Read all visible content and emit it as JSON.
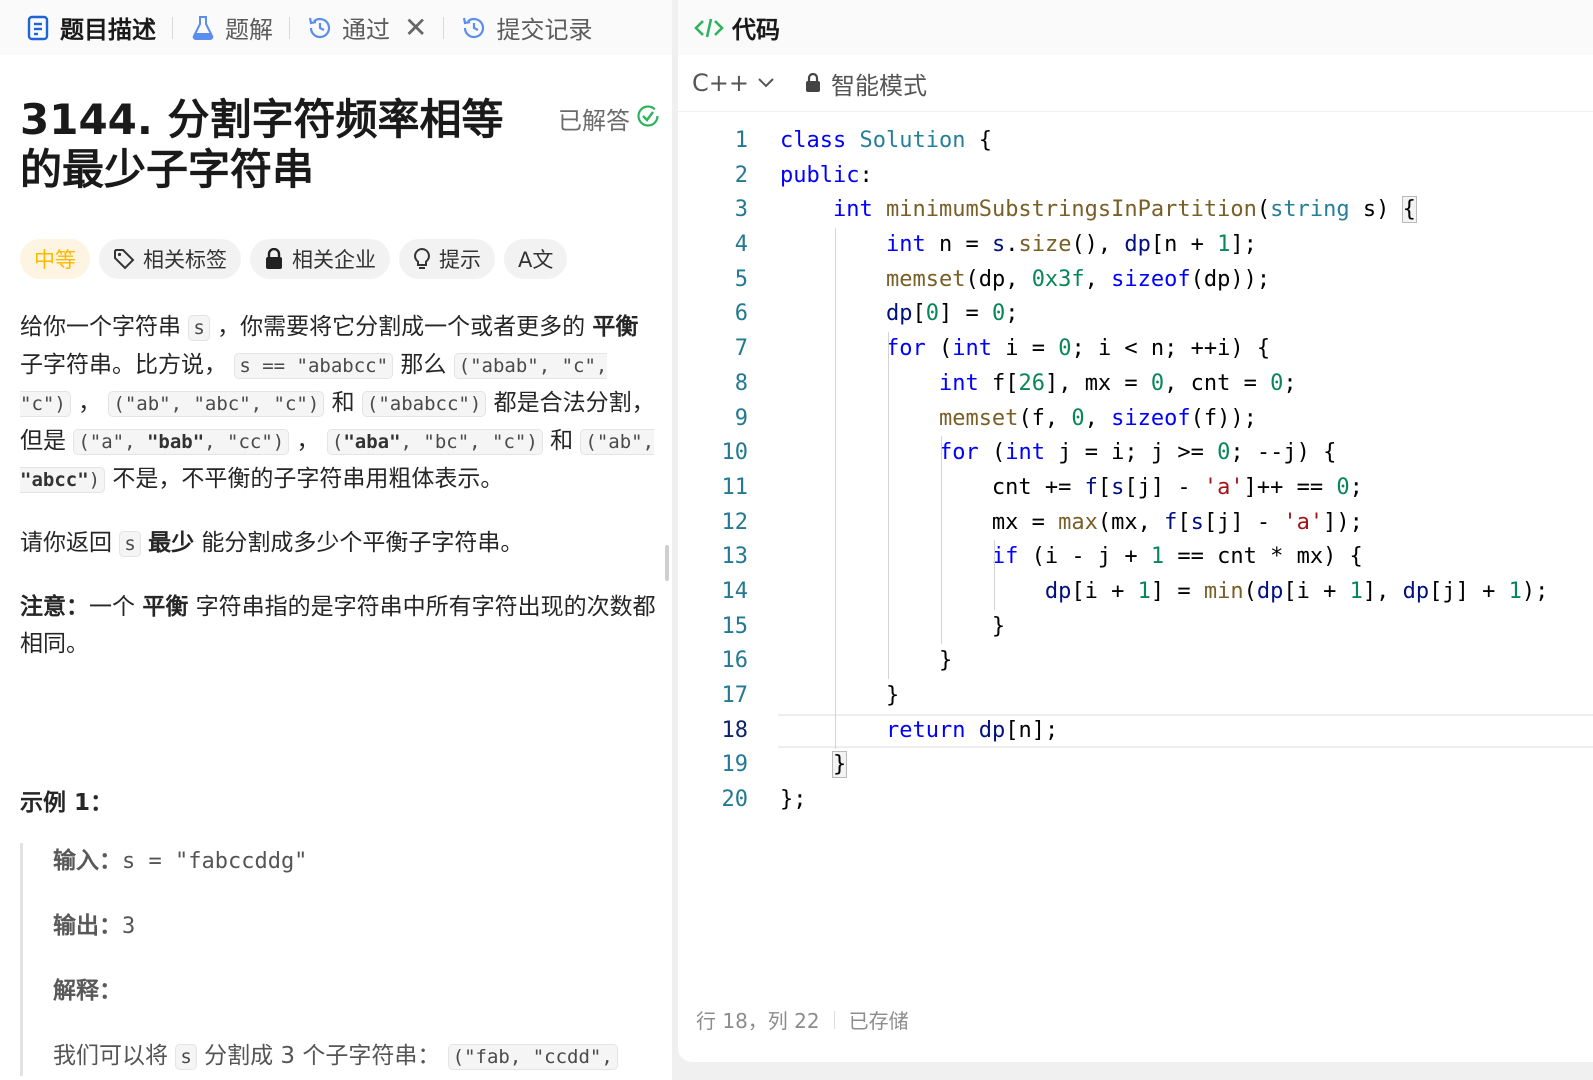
{
  "tabs": [
    {
      "label": "题目描述",
      "icon": "description-icon",
      "active": true
    },
    {
      "label": "题解",
      "icon": "flask-icon"
    },
    {
      "label": "通过",
      "icon": "history-icon",
      "closable": true
    },
    {
      "label": "提交记录",
      "icon": "history-icon"
    }
  ],
  "tab_close": "✕",
  "problem": {
    "title": "3144. 分割字符频率相等的最少子字符串",
    "status": "已解答",
    "tags": [
      {
        "label": "中等",
        "icon": ""
      },
      {
        "label": "相关标签",
        "icon": "tag-icon"
      },
      {
        "label": "相关企业",
        "icon": "lock-icon"
      },
      {
        "label": "提示",
        "icon": "lightbulb-icon"
      },
      {
        "label": "A文",
        "icon": "translate-icon"
      }
    ],
    "desc1": {
      "t1": "给你一个字符串 ",
      "c1": "s",
      "t2": " ，你需要将它分割成一个或者更多的 ",
      "b1": "平衡",
      "t3": " 子字符串。比方说， ",
      "c2": "s == \"ababcc\"",
      "t4": " 那么 ",
      "c3": "(\"abab\", \"c\", \"c\")",
      "t5": " ， ",
      "c4": "(\"ab\", \"abc\", \"c\")",
      "t6": " 和 ",
      "c5": "(\"ababcc\")",
      "t7": " 都是合法分割，但是 ",
      "c6a": "(\"a\", ",
      "c6b": "\"bab\"",
      "c6c": ", \"cc\")",
      "t8": " ， ",
      "c7a": "(",
      "c7b": "\"aba\"",
      "c7c": ", \"bc\", \"c\")",
      "t9": " 和 ",
      "c8a": "(\"ab\", ",
      "c8b": "\"abcc\"",
      "c8c": ")",
      "t10": " 不是，不平衡的子字符串用粗体表示。"
    },
    "desc2": {
      "t1": "请你返回 ",
      "c1": "s",
      "t2": " ",
      "b1": "最少",
      "t3": " 能分割成多少个平衡子字符串。"
    },
    "note": {
      "b1": "注意：",
      "t1": "一个 ",
      "b2": "平衡",
      "t2": " 字符串指的是字符串中所有字符出现的次数都相同。"
    },
    "example": {
      "title": "示例 1：",
      "input_label": "输入：",
      "input_value": "s = \"fabccddg\"",
      "output_label": "输出：",
      "output_value": "3",
      "explain_label": "解释：",
      "explain_t1": "我们可以将 ",
      "explain_c1": "s",
      "explain_t2": " 分割成 3 个子字符串： ",
      "explain_c2": "(\"fab, \"ccdd\","
    }
  },
  "editor": {
    "header": "代码",
    "language": "C++",
    "mode": "智能模式",
    "status_position": "行 18，列 22",
    "status_saved": "已存储",
    "current_line": 18,
    "lines": [
      [
        {
          "c": "kw",
          "t": "class"
        },
        {
          "c": "",
          "t": " "
        },
        {
          "c": "ty",
          "t": "Solution"
        },
        {
          "c": "",
          "t": " {"
        }
      ],
      [
        {
          "c": "kw",
          "t": "public"
        },
        {
          "c": "",
          "t": ":"
        }
      ],
      [
        {
          "c": "",
          "t": "    "
        },
        {
          "c": "kw",
          "t": "int"
        },
        {
          "c": "",
          "t": " "
        },
        {
          "c": "fn",
          "t": "minimumSubstringsInPartition"
        },
        {
          "c": "",
          "t": "("
        },
        {
          "c": "ty",
          "t": "string"
        },
        {
          "c": "",
          "t": " s) "
        },
        {
          "c": "br",
          "t": "{"
        }
      ],
      [
        {
          "c": "",
          "t": "        "
        },
        {
          "c": "kw",
          "t": "int"
        },
        {
          "c": "",
          "t": " n = "
        },
        {
          "c": "vr",
          "t": "s"
        },
        {
          "c": "",
          "t": "."
        },
        {
          "c": "fn",
          "t": "size"
        },
        {
          "c": "",
          "t": "(), "
        },
        {
          "c": "vr",
          "t": "dp"
        },
        {
          "c": "",
          "t": "[n + "
        },
        {
          "c": "nm",
          "t": "1"
        },
        {
          "c": "",
          "t": "];"
        }
      ],
      [
        {
          "c": "",
          "t": "        "
        },
        {
          "c": "fn",
          "t": "memset"
        },
        {
          "c": "",
          "t": "(dp, "
        },
        {
          "c": "nm",
          "t": "0x3f"
        },
        {
          "c": "",
          "t": ", "
        },
        {
          "c": "kw",
          "t": "sizeof"
        },
        {
          "c": "",
          "t": "(dp));"
        }
      ],
      [
        {
          "c": "",
          "t": "        "
        },
        {
          "c": "vr",
          "t": "dp"
        },
        {
          "c": "",
          "t": "["
        },
        {
          "c": "nm",
          "t": "0"
        },
        {
          "c": "",
          "t": "] = "
        },
        {
          "c": "nm",
          "t": "0"
        },
        {
          "c": "",
          "t": ";"
        }
      ],
      [
        {
          "c": "",
          "t": "        "
        },
        {
          "c": "kw",
          "t": "for"
        },
        {
          "c": "",
          "t": " ("
        },
        {
          "c": "kw",
          "t": "int"
        },
        {
          "c": "",
          "t": " i = "
        },
        {
          "c": "nm",
          "t": "0"
        },
        {
          "c": "",
          "t": "; i < n; ++i) {"
        }
      ],
      [
        {
          "c": "",
          "t": "            "
        },
        {
          "c": "kw",
          "t": "int"
        },
        {
          "c": "",
          "t": " f["
        },
        {
          "c": "nm",
          "t": "26"
        },
        {
          "c": "",
          "t": "], mx = "
        },
        {
          "c": "nm",
          "t": "0"
        },
        {
          "c": "",
          "t": ", cnt = "
        },
        {
          "c": "nm",
          "t": "0"
        },
        {
          "c": "",
          "t": ";"
        }
      ],
      [
        {
          "c": "",
          "t": "            "
        },
        {
          "c": "fn",
          "t": "memset"
        },
        {
          "c": "",
          "t": "(f, "
        },
        {
          "c": "nm",
          "t": "0"
        },
        {
          "c": "",
          "t": ", "
        },
        {
          "c": "kw",
          "t": "sizeof"
        },
        {
          "c": "",
          "t": "(f));"
        }
      ],
      [
        {
          "c": "",
          "t": "            "
        },
        {
          "c": "kw",
          "t": "for"
        },
        {
          "c": "",
          "t": " ("
        },
        {
          "c": "kw",
          "t": "int"
        },
        {
          "c": "",
          "t": " j = i; j >= "
        },
        {
          "c": "nm",
          "t": "0"
        },
        {
          "c": "",
          "t": "; --j) {"
        }
      ],
      [
        {
          "c": "",
          "t": "                cnt += "
        },
        {
          "c": "vr",
          "t": "f"
        },
        {
          "c": "",
          "t": "["
        },
        {
          "c": "vr",
          "t": "s"
        },
        {
          "c": "",
          "t": "[j] - "
        },
        {
          "c": "st",
          "t": "'a'"
        },
        {
          "c": "",
          "t": "]++ == "
        },
        {
          "c": "nm",
          "t": "0"
        },
        {
          "c": "",
          "t": ";"
        }
      ],
      [
        {
          "c": "",
          "t": "                mx = "
        },
        {
          "c": "fn",
          "t": "max"
        },
        {
          "c": "",
          "t": "(mx, "
        },
        {
          "c": "vr",
          "t": "f"
        },
        {
          "c": "",
          "t": "["
        },
        {
          "c": "vr",
          "t": "s"
        },
        {
          "c": "",
          "t": "[j] - "
        },
        {
          "c": "st",
          "t": "'a'"
        },
        {
          "c": "",
          "t": "]);"
        }
      ],
      [
        {
          "c": "",
          "t": "                "
        },
        {
          "c": "kw",
          "t": "if"
        },
        {
          "c": "",
          "t": " (i - j + "
        },
        {
          "c": "nm",
          "t": "1"
        },
        {
          "c": "",
          "t": " == cnt * mx) {"
        }
      ],
      [
        {
          "c": "",
          "t": "                    "
        },
        {
          "c": "vr",
          "t": "dp"
        },
        {
          "c": "",
          "t": "[i + "
        },
        {
          "c": "nm",
          "t": "1"
        },
        {
          "c": "",
          "t": "] = "
        },
        {
          "c": "fn",
          "t": "min"
        },
        {
          "c": "",
          "t": "("
        },
        {
          "c": "vr",
          "t": "dp"
        },
        {
          "c": "",
          "t": "[i + "
        },
        {
          "c": "nm",
          "t": "1"
        },
        {
          "c": "",
          "t": "], "
        },
        {
          "c": "vr",
          "t": "dp"
        },
        {
          "c": "",
          "t": "[j] + "
        },
        {
          "c": "nm",
          "t": "1"
        },
        {
          "c": "",
          "t": ");"
        }
      ],
      [
        {
          "c": "",
          "t": "                }"
        }
      ],
      [
        {
          "c": "",
          "t": "            }"
        }
      ],
      [
        {
          "c": "",
          "t": "        }"
        }
      ],
      [
        {
          "c": "",
          "t": "        "
        },
        {
          "c": "kw",
          "t": "return"
        },
        {
          "c": "",
          "t": " "
        },
        {
          "c": "vr",
          "t": "dp"
        },
        {
          "c": "",
          "t": "[n];"
        }
      ],
      [
        {
          "c": "",
          "t": "    "
        },
        {
          "c": "br",
          "t": "}"
        }
      ],
      [
        {
          "c": "",
          "t": "};"
        }
      ]
    ]
  },
  "colors": {
    "accent_green": "#2db55d",
    "difficulty": "#ffb800",
    "tab_icon_blue": "#1e64d6"
  }
}
